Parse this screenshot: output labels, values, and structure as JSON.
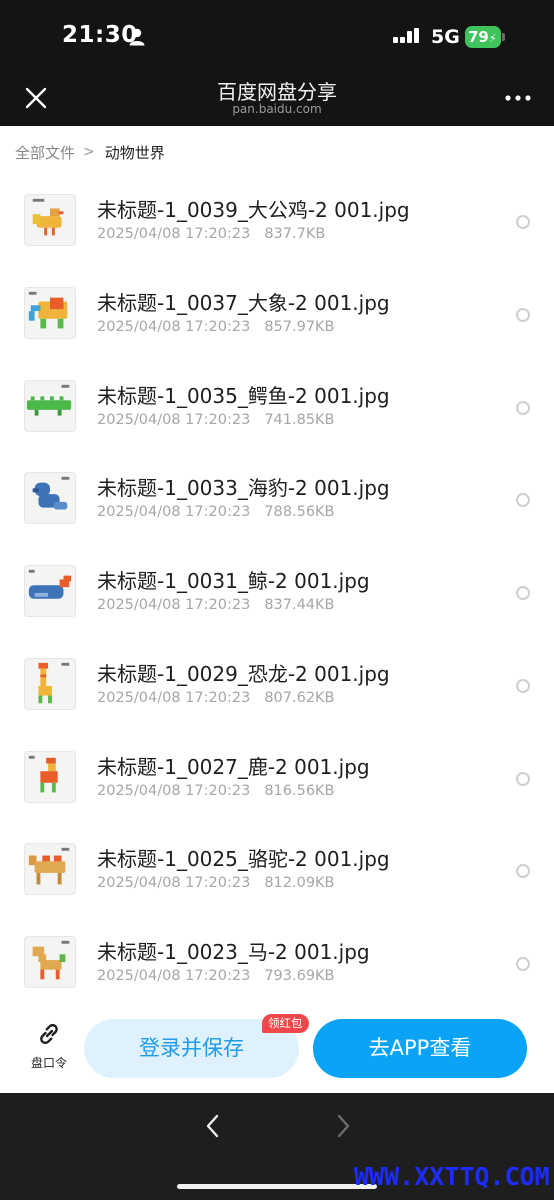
{
  "status_bar": {
    "time": "21:30",
    "network": "5G",
    "battery": "79"
  },
  "header": {
    "title": "百度网盘分享",
    "subtitle": "pan.baidu.com"
  },
  "breadcrumb": {
    "root": "全部文件",
    "separator": ">",
    "current": "动物世界"
  },
  "files": [
    {
      "name": "未标题-1_0039_大公鸡-2 001.jpg",
      "date": "2025/04/08 17:20:23",
      "size": "837.7KB",
      "thumb": "rooster-thumbnail"
    },
    {
      "name": "未标题-1_0037_大象-2 001.jpg",
      "date": "2025/04/08 17:20:23",
      "size": "857.97KB",
      "thumb": "elephant-thumbnail"
    },
    {
      "name": "未标题-1_0035_鳄鱼-2 001.jpg",
      "date": "2025/04/08 17:20:23",
      "size": "741.85KB",
      "thumb": "crocodile-thumbnail"
    },
    {
      "name": "未标题-1_0033_海豹-2 001.jpg",
      "date": "2025/04/08 17:20:23",
      "size": "788.56KB",
      "thumb": "seal-thumbnail"
    },
    {
      "name": "未标题-1_0031_鲸-2 001.jpg",
      "date": "2025/04/08 17:20:23",
      "size": "837.44KB",
      "thumb": "whale-thumbnail"
    },
    {
      "name": "未标题-1_0029_恐龙-2 001.jpg",
      "date": "2025/04/08 17:20:23",
      "size": "807.62KB",
      "thumb": "dinosaur-thumbnail"
    },
    {
      "name": "未标题-1_0027_鹿-2 001.jpg",
      "date": "2025/04/08 17:20:23",
      "size": "816.56KB",
      "thumb": "deer-thumbnail"
    },
    {
      "name": "未标题-1_0025_骆驼-2 001.jpg",
      "date": "2025/04/08 17:20:23",
      "size": "812.09KB",
      "thumb": "camel-thumbnail"
    },
    {
      "name": "未标题-1_0023_马-2 001.jpg",
      "date": "2025/04/08 17:20:23",
      "size": "793.69KB",
      "thumb": "horse-thumbnail"
    }
  ],
  "actions": {
    "password_label": "盘口令",
    "save_label": "登录并保存",
    "red_packet_badge": "领红包",
    "open_app_label": "去APP查看"
  },
  "watermark": "WWW.XXTTQ.COM",
  "colors": {
    "primary": "#0aa3f5",
    "primary_light": "#dff1fc",
    "badge_red": "#f0484a",
    "battery_green": "#3ec45a"
  }
}
